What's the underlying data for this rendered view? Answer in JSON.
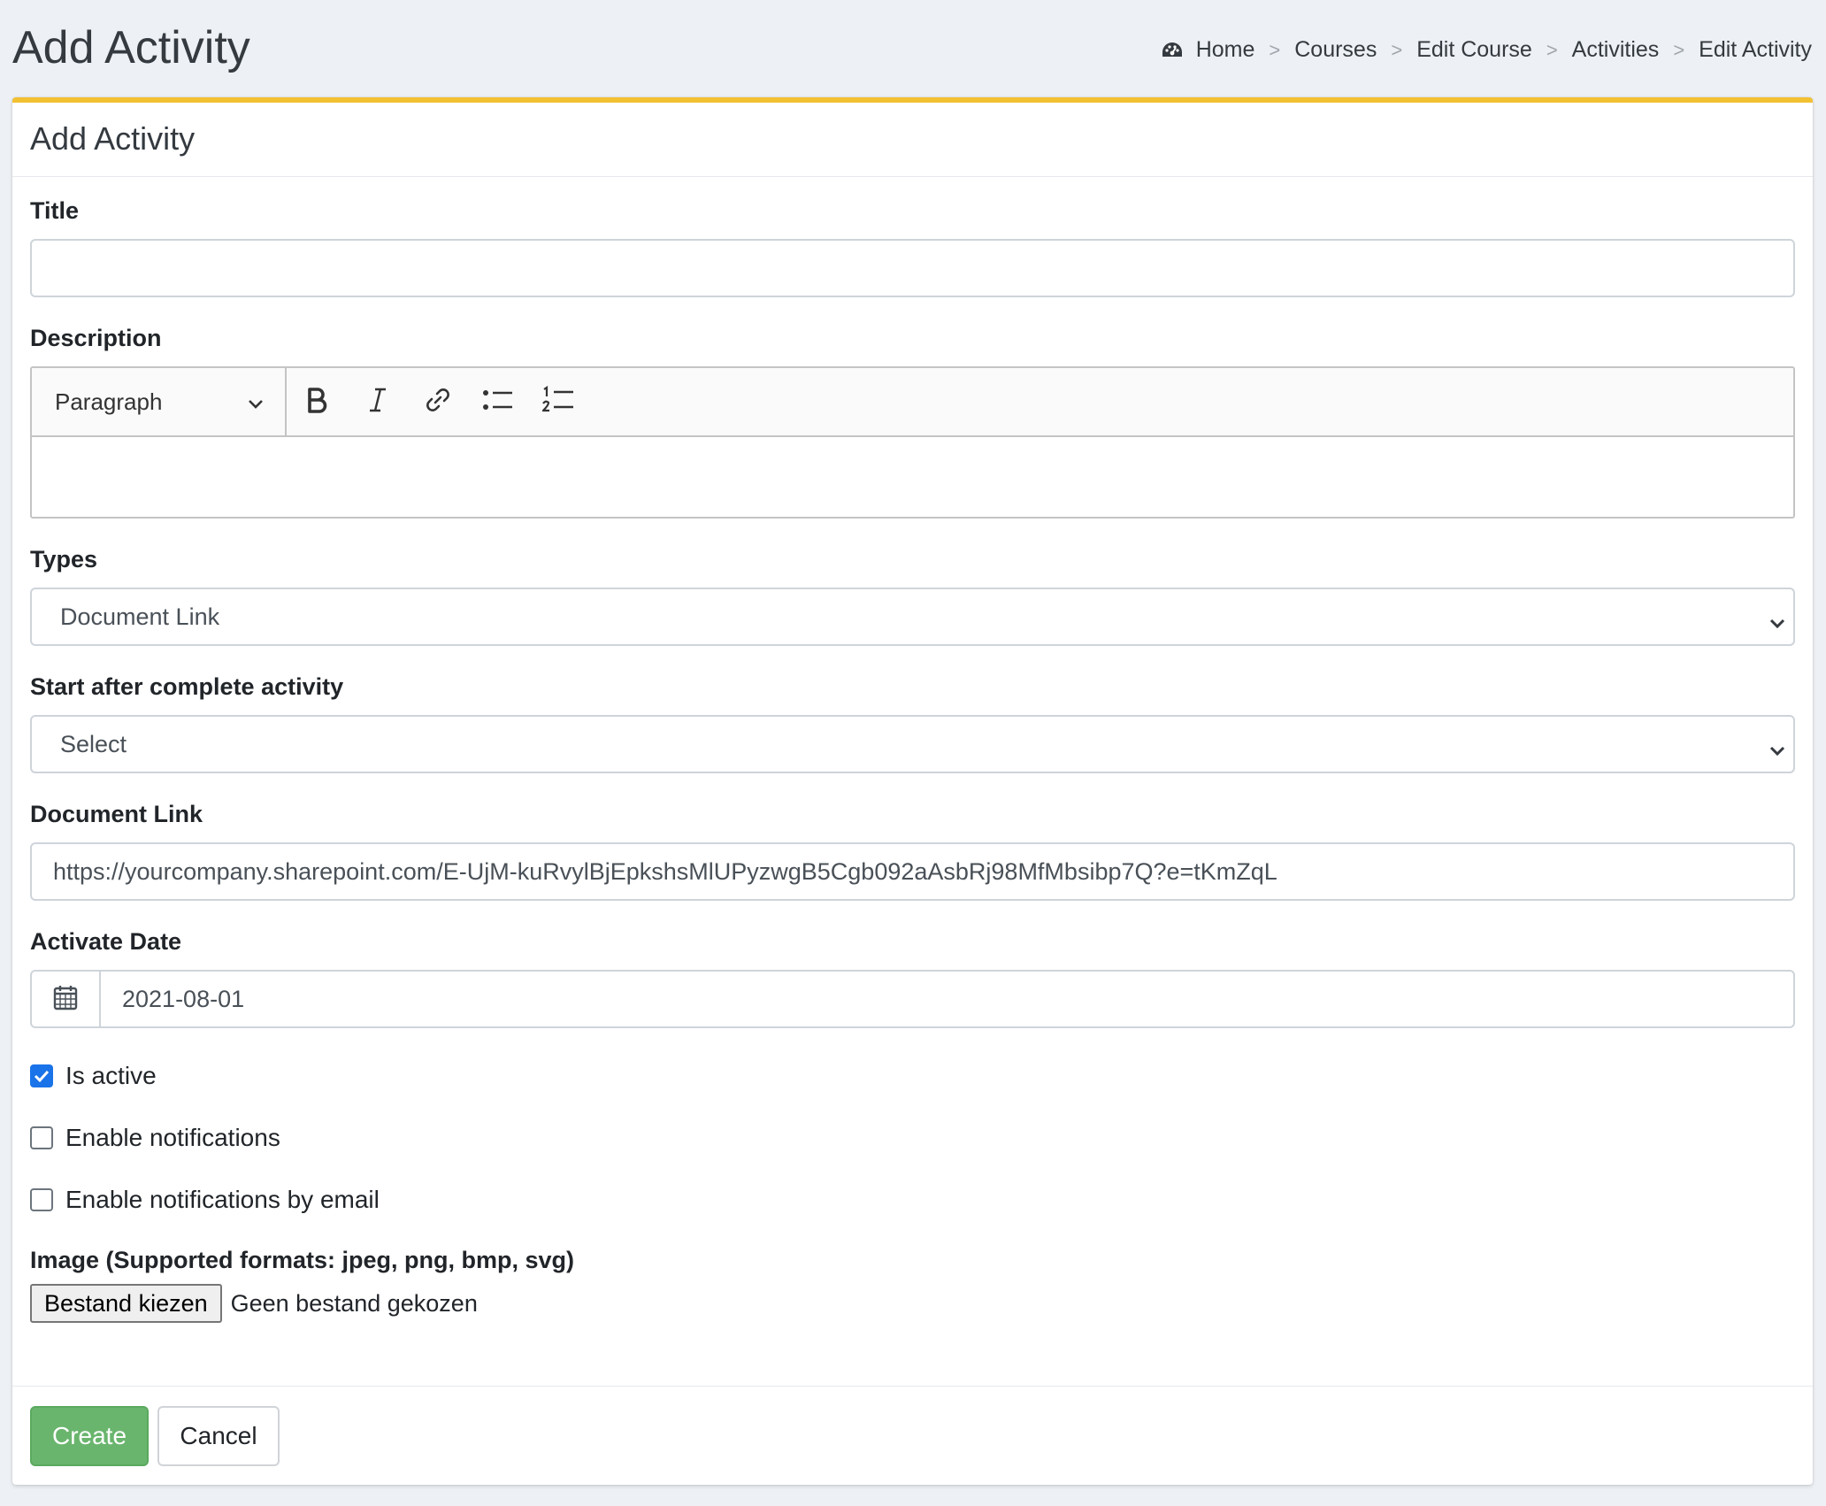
{
  "header": {
    "title": "Add Activity",
    "breadcrumb": [
      "Home",
      "Courses",
      "Edit Course",
      "Activities",
      "Edit Activity"
    ],
    "separator": ">"
  },
  "card": {
    "title": "Add Activity",
    "accent_color": "#f2c031"
  },
  "form": {
    "title": {
      "label": "Title",
      "value": ""
    },
    "description": {
      "label": "Description",
      "heading_select": "Paragraph",
      "toolbar_icons": [
        "bold-icon",
        "italic-icon",
        "link-icon",
        "bulleted-list-icon",
        "numbered-list-icon"
      ],
      "value": ""
    },
    "types": {
      "label": "Types",
      "selected": "Document Link"
    },
    "start_after": {
      "label": "Start after complete activity",
      "selected": "Select"
    },
    "document_link": {
      "label": "Document Link",
      "value": "https://yourcompany.sharepoint.com/E-UjM-kuRvylBjEpkshsMlUPyzwgB5Cgb092aAsbRj98MfMbsibp7Q?e=tKmZqL"
    },
    "activate_date": {
      "label": "Activate Date",
      "value": "2021-08-01"
    },
    "checkboxes": [
      {
        "label": "Is active",
        "checked": true
      },
      {
        "label": "Enable notifications",
        "checked": false
      },
      {
        "label": "Enable notifications by email",
        "checked": false
      }
    ],
    "image": {
      "label": "Image (Supported formats: jpeg, png, bmp, svg)",
      "button": "Bestand kiezen",
      "status": "Geen bestand gekozen"
    }
  },
  "footer": {
    "create": "Create",
    "cancel": "Cancel",
    "create_color": "#6ab56e"
  }
}
